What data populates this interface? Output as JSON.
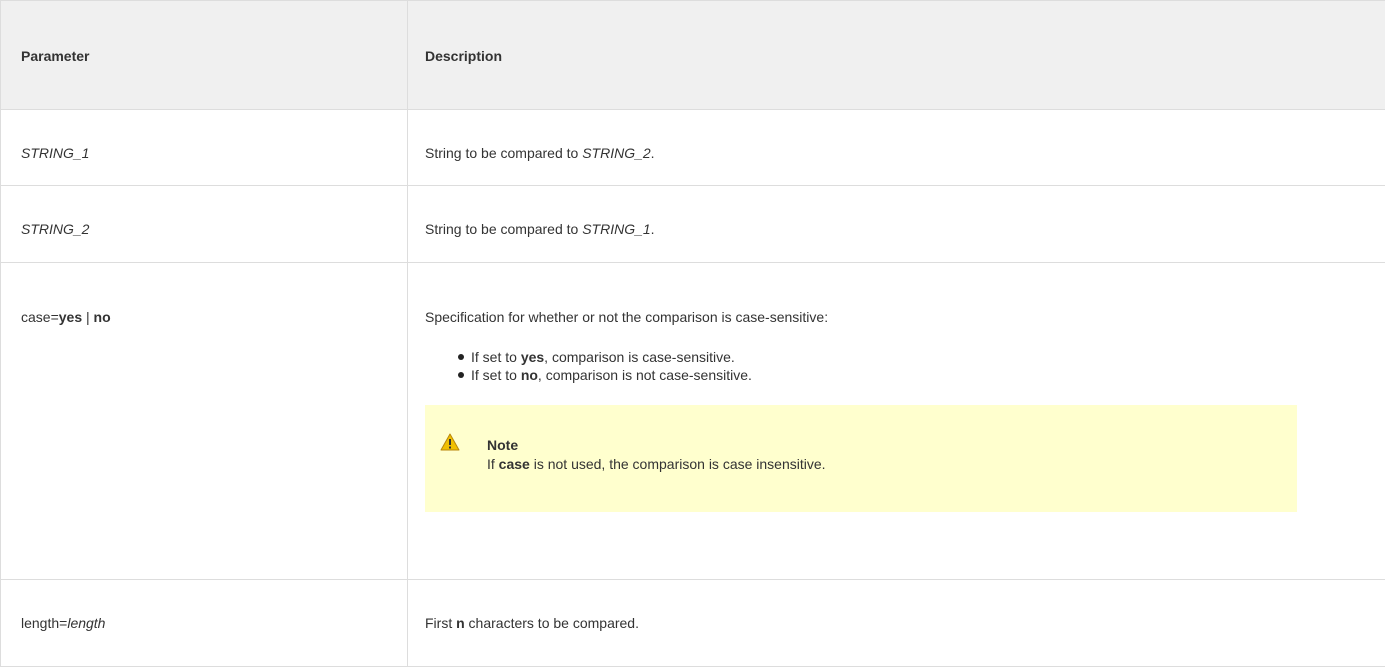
{
  "header": {
    "parameter": "Parameter",
    "description": "Description"
  },
  "rows": [
    {
      "param_italic": "STRING_1",
      "desc_prefix": "String to be compared to ",
      "desc_italic": "STRING_2",
      "desc_suffix": "."
    },
    {
      "param_italic": "STRING_2",
      "desc_prefix": "String to be compared to ",
      "desc_italic": "STRING_1",
      "desc_suffix": "."
    },
    {
      "param_prefix": "case=",
      "param_yes": "yes",
      "param_sep": " | ",
      "param_no": "no",
      "desc_text": "Specification for whether or not the comparison is case-sensitive:",
      "bullets": [
        {
          "prefix": "If set to ",
          "bold": "yes",
          "suffix": ", comparison is case-sensitive."
        },
        {
          "prefix": "If set to ",
          "bold": "no",
          "suffix": ", comparison is not case-sensitive."
        }
      ],
      "note": {
        "icon": "warning-icon",
        "title": "Note",
        "prefix": "If ",
        "bold": "case",
        "suffix": " is not used, the comparison is case insensitive."
      }
    },
    {
      "param_prefix": "length=",
      "param_italic": "length",
      "desc_prefix": "First ",
      "desc_bold": "n",
      "desc_suffix": " characters to be compared."
    }
  ],
  "colors": {
    "header_bg": "#f0f0f0",
    "border": "#dddddd",
    "note_bg": "#ffffce",
    "warning_icon": "#f0c000"
  }
}
